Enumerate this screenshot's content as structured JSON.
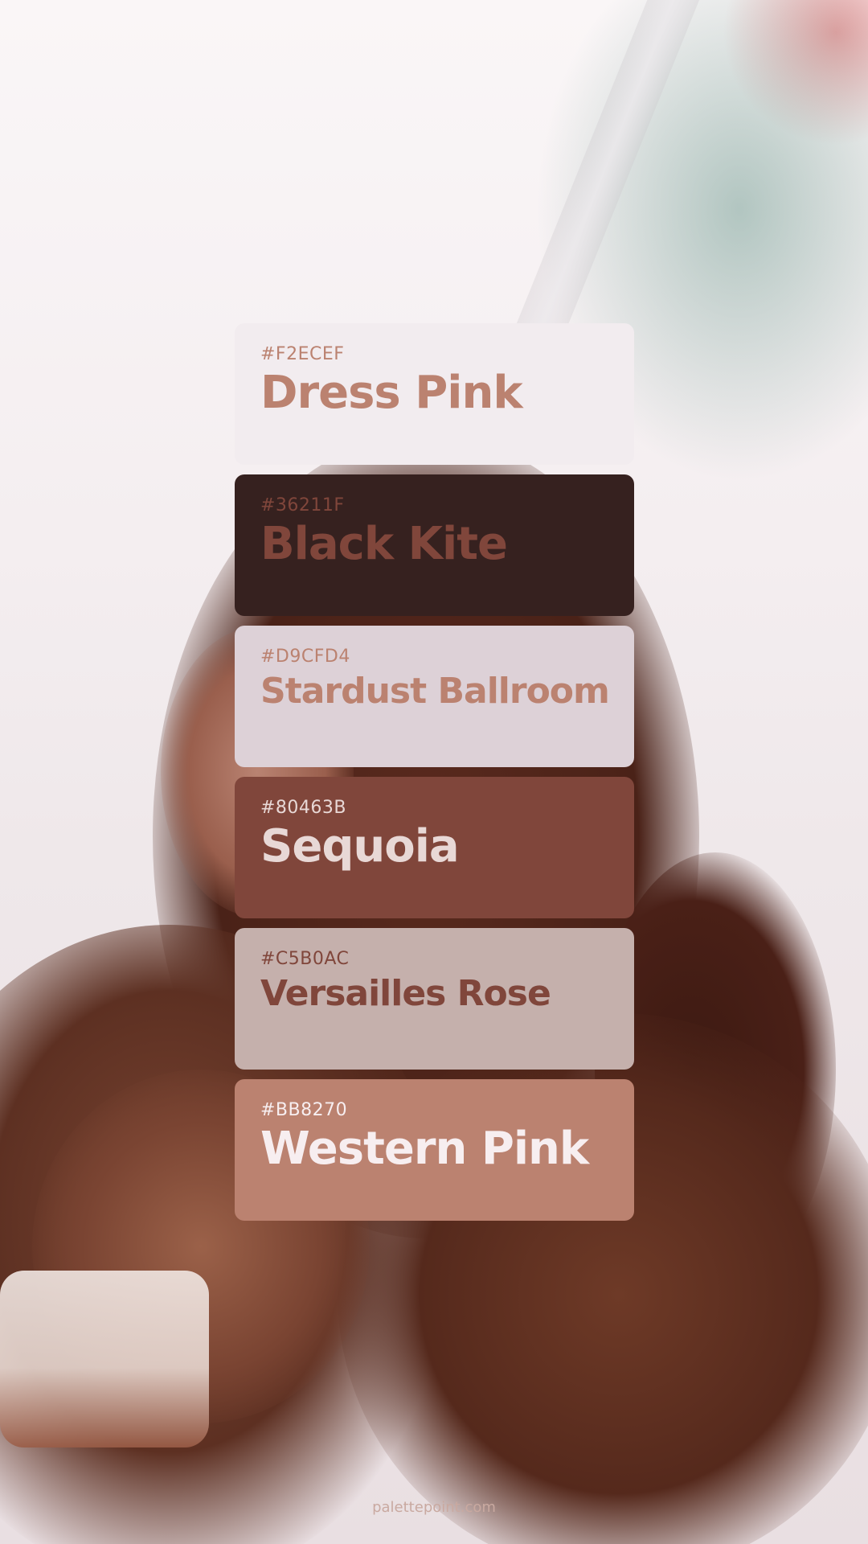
{
  "swatches": [
    {
      "hex": "#F2ECEF",
      "name": "Dress Pink",
      "bg": "#F2ECEF",
      "text": "#BB8270"
    },
    {
      "hex": "#36211F",
      "name": "Black Kite",
      "bg": "#36211F",
      "text": "#80463B"
    },
    {
      "hex": "#D9CFD4",
      "name": "Stardust Ballroom",
      "bg": "#DDD1D7",
      "text": "#BB8270"
    },
    {
      "hex": "#80463B",
      "name": "Sequoia",
      "bg": "#80463B",
      "text": "#E8D8D6"
    },
    {
      "hex": "#C5B0AC",
      "name": "Versailles Rose",
      "bg": "#C5B0AC",
      "text": "#80463B"
    },
    {
      "hex": "#BB8270",
      "name": "Western Pink",
      "bg": "#BB8270",
      "text": "#F7EEF0"
    }
  ],
  "footer": "palettepoint.com"
}
